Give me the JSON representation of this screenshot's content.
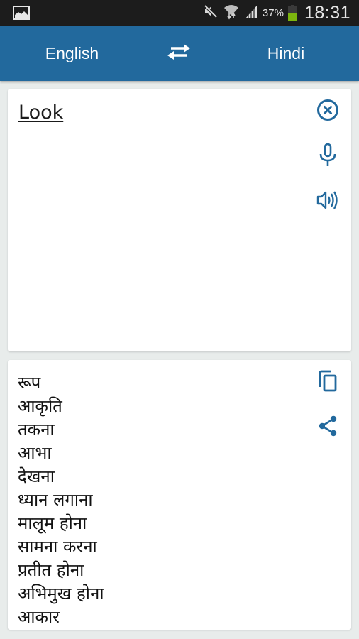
{
  "status_bar": {
    "notification_icon": "image-icon",
    "icons": [
      "mute-icon",
      "wifi-icon",
      "signal-icon"
    ],
    "battery_percent": "37%",
    "battery_level": 0.37,
    "time": "18:31"
  },
  "app_bar": {
    "source_language": "English",
    "target_language": "Hindi",
    "swap_icon": "swap-arrows-icon"
  },
  "input_card": {
    "text": "Look",
    "actions": [
      {
        "name": "clear",
        "icon": "clear-circle-icon"
      },
      {
        "name": "voice-input",
        "icon": "microphone-icon"
      },
      {
        "name": "speak",
        "icon": "speaker-icon"
      }
    ]
  },
  "output_card": {
    "translations": [
      "रूप",
      "आकृति",
      "तकना",
      "आभा",
      "देखना",
      "ध्यान लगाना",
      "मालूम होना",
      "सामना करना",
      "प्रतीत होना",
      "अभिमुख होना",
      "आकार"
    ],
    "actions": [
      {
        "name": "copy",
        "icon": "copy-icon"
      },
      {
        "name": "share",
        "icon": "share-icon"
      }
    ]
  },
  "colors": {
    "accent": "#22699d",
    "status_bar": "#1c1c1c",
    "background": "#e8eceb",
    "battery_fill": "#7cb50e"
  }
}
